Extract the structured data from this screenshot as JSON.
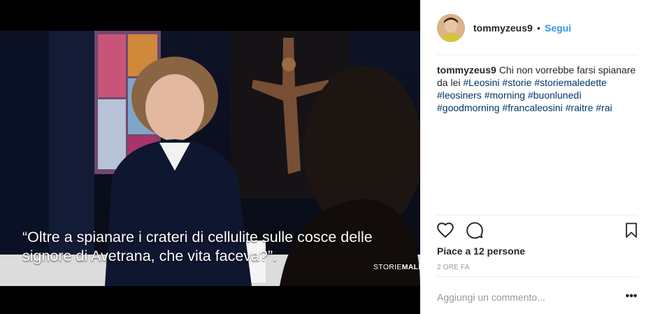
{
  "post": {
    "caption_overlay_line1": "“Oltre a spianare i crateri di cellulite sulle cosce delle",
    "caption_overlay_line2": "signore di Avetrana, che vita faceva?”.",
    "show_logo_light": "STORIE",
    "show_logo_bold": "MALEDE"
  },
  "header": {
    "username": "tommyzeus9",
    "separator": "•",
    "follow_label": "Segui",
    "avatar_icon": "user-avatar-icon"
  },
  "comment": {
    "username": "tommyzeus9",
    "text_part1": "Chi non vorrebbe farsi spianare da lei",
    "hashtags": [
      "#Leosini",
      "#storie",
      "#storiemaledette",
      "#leosiners",
      "#morning",
      "#buonlunedì",
      "#goodmorning",
      "#francaleosini",
      "#raitre",
      "#rai"
    ]
  },
  "actions": {
    "like_icon": "heart-icon",
    "comment_icon": "comment-icon",
    "save_icon": "bookmark-icon",
    "likes_text": "Piace a 12 persone",
    "timestamp": "2 ORE FA"
  },
  "add_comment": {
    "placeholder": "Aggiungi un commento...",
    "more_label": "•••"
  },
  "colors": {
    "link": "#3897f0",
    "hashtag": "#003569",
    "text": "#262626",
    "muted": "#999999",
    "divider": "#efefef"
  }
}
